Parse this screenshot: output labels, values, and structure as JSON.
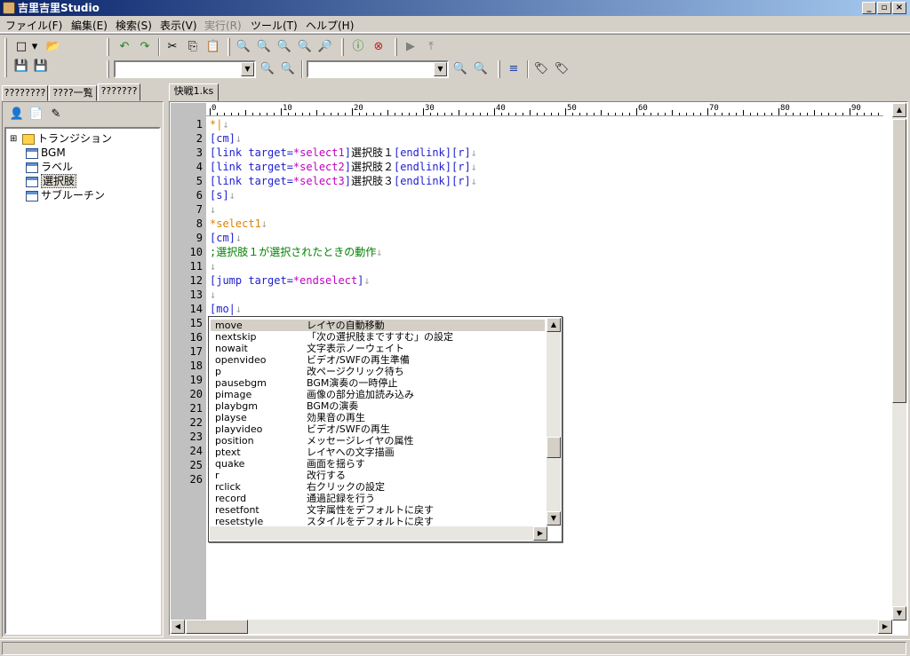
{
  "window": {
    "title": "吉里吉里Studio",
    "controls": [
      "_",
      "▫",
      "×"
    ]
  },
  "menu": [
    {
      "label": "ファイル(F)",
      "disabled": false
    },
    {
      "label": "編集(E)",
      "disabled": false
    },
    {
      "label": "検索(S)",
      "disabled": false
    },
    {
      "label": "表示(V)",
      "disabled": false
    },
    {
      "label": "実行(R)",
      "disabled": true
    },
    {
      "label": "ツール(T)",
      "disabled": false
    },
    {
      "label": "ヘルプ(H)",
      "disabled": false
    }
  ],
  "toolbar": {
    "icons": {
      "new": "□",
      "new_drop": "▾",
      "open": "📂",
      "save": "💾",
      "save_all": "💾",
      "undo": "↶",
      "redo": "↷",
      "cut": "✂",
      "copy": "⎘",
      "paste": "📋",
      "find": "🔍",
      "find_next": "🔍",
      "find_prev": "🔍",
      "replace": "🔍",
      "find_files": "🔎",
      "info": "ⓘ",
      "stop": "⊗",
      "run": "▶",
      "step": "⤒",
      "combo1_btn1": "🔍",
      "combo1_btn2": "🔍",
      "combo2_btn1": "🔍",
      "combo2_btn2": "🔍",
      "indent": "≡",
      "tag1": "🏷",
      "tag2": "🏷"
    },
    "combo1_value": "",
    "combo2_value": ""
  },
  "left_tabs": [
    {
      "label": "????????",
      "active": false
    },
    {
      "label": "????一覧",
      "active": false
    },
    {
      "label": "???????",
      "active": true
    }
  ],
  "tree": {
    "toolbar_icons": [
      "👤",
      "📄",
      "✎"
    ],
    "expander": "⊞",
    "items": [
      {
        "label": "トランジション",
        "icon": "folder-icon",
        "selected": false
      },
      {
        "label": "BGM",
        "icon": "document-icon",
        "selected": false
      },
      {
        "label": "ラベル",
        "icon": "document-icon",
        "selected": false
      },
      {
        "label": "選択肢",
        "icon": "document-icon",
        "selected": true
      },
      {
        "label": "サブルーチン",
        "icon": "document-icon",
        "selected": false
      }
    ]
  },
  "editor": {
    "tab_label": "快戦1.ks",
    "ruler_labels": [
      "0",
      "10",
      "20",
      "30",
      "40",
      "50",
      "60",
      "70",
      "80",
      "90"
    ],
    "line_numbers": [
      "1",
      "2",
      "3",
      "4",
      "5",
      "6",
      "7",
      "8",
      "9",
      "10",
      "11",
      "12",
      "13",
      "14",
      "15",
      "16",
      "17",
      "18",
      "19",
      "20",
      "21",
      "22",
      "23",
      "24",
      "25",
      "26"
    ],
    "lines": [
      [
        {
          "t": "*|",
          "c": "org"
        },
        {
          "t": "↓",
          "c": "ret"
        }
      ],
      [
        {
          "t": "[cm]",
          "c": "blu"
        },
        {
          "t": "↓",
          "c": "ret"
        }
      ],
      [
        {
          "t": "[link target=",
          "c": "blu"
        },
        {
          "t": "*select1",
          "c": "mag"
        },
        {
          "t": "]",
          "c": "blu"
        },
        {
          "t": "選択肢１",
          "c": "blk"
        },
        {
          "t": "[endlink][r]",
          "c": "blu"
        },
        {
          "t": "↓",
          "c": "ret"
        }
      ],
      [
        {
          "t": "[link target=",
          "c": "blu"
        },
        {
          "t": "*select2",
          "c": "mag"
        },
        {
          "t": "]",
          "c": "blu"
        },
        {
          "t": "選択肢２",
          "c": "blk"
        },
        {
          "t": "[endlink][r]",
          "c": "blu"
        },
        {
          "t": "↓",
          "c": "ret"
        }
      ],
      [
        {
          "t": "[link target=",
          "c": "blu"
        },
        {
          "t": "*select3",
          "c": "mag"
        },
        {
          "t": "]",
          "c": "blu"
        },
        {
          "t": "選択肢３",
          "c": "blk"
        },
        {
          "t": "[endlink][r]",
          "c": "blu"
        },
        {
          "t": "↓",
          "c": "ret"
        }
      ],
      [
        {
          "t": "[s]",
          "c": "blu"
        },
        {
          "t": "↓",
          "c": "ret"
        }
      ],
      [
        {
          "t": "↓",
          "c": "ret"
        }
      ],
      [
        {
          "t": "*select1",
          "c": "org"
        },
        {
          "t": "↓",
          "c": "ret"
        }
      ],
      [
        {
          "t": "[cm]",
          "c": "blu"
        },
        {
          "t": "↓",
          "c": "ret"
        }
      ],
      [
        {
          "t": ";選択肢１が選択されたときの動作",
          "c": "grn"
        },
        {
          "t": "↓",
          "c": "ret"
        }
      ],
      [
        {
          "t": "↓",
          "c": "ret"
        }
      ],
      [
        {
          "t": "[jump target=",
          "c": "blu"
        },
        {
          "t": "*endselect",
          "c": "mag"
        },
        {
          "t": "]",
          "c": "blu"
        },
        {
          "t": "↓",
          "c": "ret"
        }
      ],
      [
        {
          "t": "↓",
          "c": "ret"
        }
      ],
      [
        {
          "t": "[mo|",
          "c": "blu"
        },
        {
          "t": "↓",
          "c": "ret"
        }
      ]
    ]
  },
  "autocomplete": [
    {
      "k": "move",
      "d": "レイヤの自動移動",
      "hl": true
    },
    {
      "k": "nextskip",
      "d": "「次の選択肢まですすむ」の設定"
    },
    {
      "k": "nowait",
      "d": "文字表示ノーウェイト"
    },
    {
      "k": "openvideo",
      "d": "ビデオ/SWFの再生準備"
    },
    {
      "k": "p",
      "d": "改ページクリック待ち"
    },
    {
      "k": "pausebgm",
      "d": "BGM演奏の一時停止"
    },
    {
      "k": "pimage",
      "d": "画像の部分追加読み込み"
    },
    {
      "k": "playbgm",
      "d": "BGMの演奏"
    },
    {
      "k": "playse",
      "d": "効果音の再生"
    },
    {
      "k": "playvideo",
      "d": "ビデオ/SWFの再生"
    },
    {
      "k": "position",
      "d": "メッセージレイヤの属性"
    },
    {
      "k": "ptext",
      "d": "レイヤへの文字描画"
    },
    {
      "k": "quake",
      "d": "画面を揺らす"
    },
    {
      "k": "r",
      "d": "改行する"
    },
    {
      "k": "rclick",
      "d": "右クリックの設定"
    },
    {
      "k": "record",
      "d": "通過記録を行う"
    },
    {
      "k": "resetfont",
      "d": "文字属性をデフォルトに戻す"
    },
    {
      "k": "resetstyle",
      "d": "スタイルをデフォルトに戻す"
    }
  ],
  "scroll": {
    "up": "▲",
    "down": "▼",
    "left": "◀",
    "right": "▶"
  },
  "colors": {
    "titlebar": "#0a246a",
    "keyword": "#2020d0",
    "label": "#e08000",
    "attr": "#c000c0",
    "comment": "#008000"
  }
}
